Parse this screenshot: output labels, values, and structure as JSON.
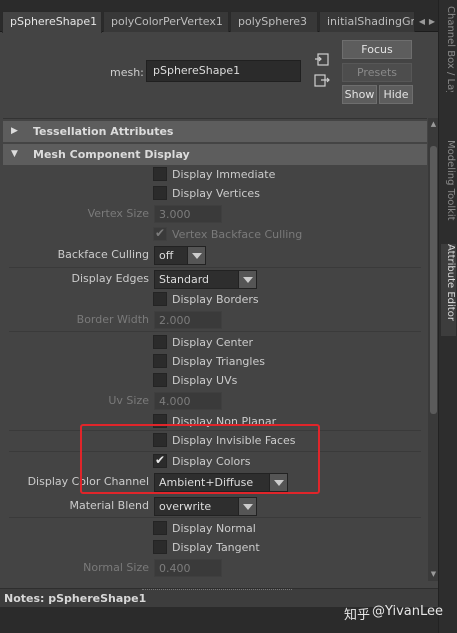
{
  "tabs": [
    {
      "label": "pSphereShape1",
      "active": true
    },
    {
      "label": "polyColorPerVertex1",
      "active": false
    },
    {
      "label": "polySphere3",
      "active": false
    },
    {
      "label": "initialShadingGr",
      "active": false
    }
  ],
  "dock_tabs": [
    "Channel Box / Layer Editor",
    "Modeling Toolkit",
    "Attribute Editor"
  ],
  "header": {
    "mesh_label": "mesh:",
    "mesh_value": "pSphereShape1",
    "focus_label": "Focus",
    "presets_label": "Presets",
    "show_label": "Show",
    "hide_label": "Hide"
  },
  "sections": {
    "tessellation": "Tessellation Attributes",
    "mesh_component": "Mesh Component Display"
  },
  "attributes": {
    "display_immediate": {
      "text": "Display Immediate",
      "checked": false
    },
    "display_vertices": {
      "text": "Display Vertices",
      "checked": false
    },
    "vertex_size": {
      "label": "Vertex Size",
      "value": "3.000"
    },
    "vertex_backface_culling": {
      "text": "Vertex Backface Culling",
      "checked": true
    },
    "backface_culling": {
      "label": "Backface Culling",
      "value": "off"
    },
    "display_edges": {
      "label": "Display Edges",
      "value": "Standard"
    },
    "display_borders": {
      "text": "Display Borders",
      "checked": false
    },
    "border_width": {
      "label": "Border Width",
      "value": "2.000"
    },
    "display_center": {
      "text": "Display Center",
      "checked": false
    },
    "display_triangles": {
      "text": "Display Triangles",
      "checked": false
    },
    "display_uvs": {
      "text": "Display UVs",
      "checked": false
    },
    "uv_size": {
      "label": "Uv Size",
      "value": "4.000"
    },
    "display_non_planar": {
      "text": "Display Non Planar",
      "checked": false
    },
    "display_invisible_faces": {
      "text": "Display Invisible Faces",
      "checked": false
    },
    "display_colors": {
      "text": "Display Colors",
      "checked": true
    },
    "display_color_channel": {
      "label": "Display Color Channel",
      "value": "Ambient+Diffuse"
    },
    "material_blend": {
      "label": "Material Blend",
      "value": "overwrite"
    },
    "display_normal": {
      "text": "Display Normal",
      "checked": false
    },
    "display_tangent": {
      "text": "Display Tangent",
      "checked": false
    },
    "normal_size": {
      "label": "Normal Size",
      "value": "0.400"
    }
  },
  "notes": {
    "label": "Notes:  pSphereShape1"
  },
  "watermark": {
    "prefix": "知乎",
    "text": "@YivanLee"
  },
  "colors": {
    "highlight": "#e0252a",
    "panel_bg": "#444444",
    "section_bg": "#5d5d5d"
  }
}
